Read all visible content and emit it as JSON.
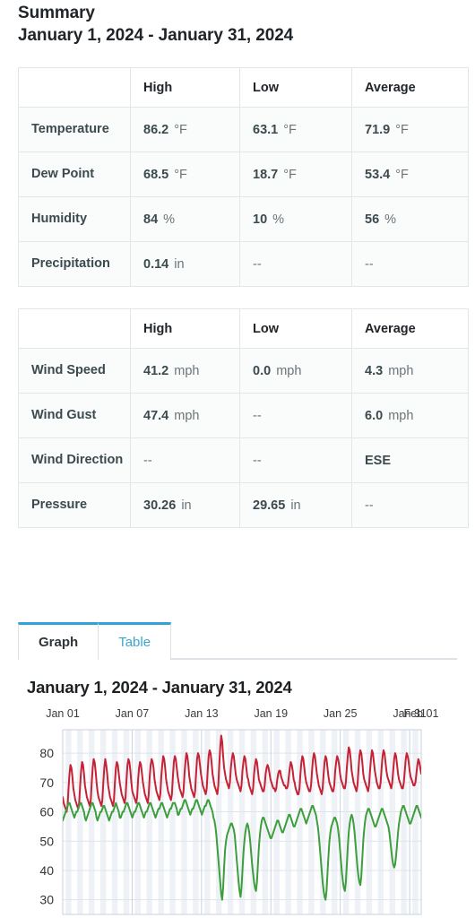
{
  "page": {
    "summary_label": "Summary",
    "date_range": "January 1, 2024 - January 31, 2024"
  },
  "table_main": {
    "headers": [
      "",
      "High",
      "Low",
      "Average"
    ],
    "rows": [
      {
        "label": "Temperature",
        "high": "86.2",
        "high_unit": "°F",
        "low": "63.1",
        "low_unit": "°F",
        "avg": "71.9",
        "avg_unit": "°F"
      },
      {
        "label": "Dew Point",
        "high": "68.5",
        "high_unit": "°F",
        "low": "18.7",
        "low_unit": "°F",
        "avg": "53.4",
        "avg_unit": "°F"
      },
      {
        "label": "Humidity",
        "high": "84",
        "high_unit": "%",
        "low": "10",
        "low_unit": "%",
        "avg": "56",
        "avg_unit": "%"
      },
      {
        "label": "Precipitation",
        "high": "0.14",
        "high_unit": "in",
        "low": "--",
        "low_unit": "",
        "avg": "--",
        "avg_unit": ""
      }
    ]
  },
  "table_wind": {
    "headers": [
      "",
      "High",
      "Low",
      "Average"
    ],
    "rows": [
      {
        "label": "Wind Speed",
        "high": "41.2",
        "high_unit": "mph",
        "low": "0.0",
        "low_unit": "mph",
        "avg": "4.3",
        "avg_unit": "mph"
      },
      {
        "label": "Wind Gust",
        "high": "47.4",
        "high_unit": "mph",
        "low": "--",
        "low_unit": "",
        "avg": "6.0",
        "avg_unit": "mph"
      },
      {
        "label": "Wind Direction",
        "high": "--",
        "high_unit": "",
        "low": "--",
        "low_unit": "",
        "avg": "ESE",
        "avg_unit": ""
      },
      {
        "label": "Pressure",
        "high": "30.26",
        "high_unit": "in",
        "low": "29.65",
        "low_unit": "in",
        "avg": "--",
        "avg_unit": ""
      }
    ]
  },
  "tabs": {
    "items": [
      {
        "label": "Graph",
        "active": true
      },
      {
        "label": "Table",
        "active": false
      }
    ]
  },
  "chart_data": {
    "type": "line",
    "title": "January 1, 2024 - January 31, 2024",
    "xlabel": "",
    "ylabel": "",
    "ylim": [
      25,
      88
    ],
    "yticks": [
      30,
      40,
      50,
      60,
      70,
      80
    ],
    "xtick_labels": [
      "Jan 01",
      "Jan 07",
      "Jan 13",
      "Jan 19",
      "Jan 25",
      "Jan 31",
      "Feb 01"
    ],
    "xtick_days": [
      0,
      6,
      12,
      18,
      24,
      30,
      31
    ],
    "x_range_days": [
      0,
      31
    ],
    "grid": true,
    "legend_position": "none",
    "band_color": "#eef2f7",
    "colors": {
      "temperature": "#c62134",
      "dew_point": "#3c9e3c"
    },
    "series": [
      {
        "name": "Temperature",
        "unit": "°F",
        "color": "#c62134",
        "values": [
          65,
          63,
          62,
          61,
          60,
          62,
          68,
          73,
          76,
          75,
          72,
          68,
          66,
          64,
          63,
          62,
          61,
          63,
          69,
          74,
          77,
          76,
          73,
          69,
          67,
          65,
          64,
          63,
          62,
          64,
          70,
          75,
          78,
          77,
          74,
          70,
          67,
          65,
          64,
          63,
          62,
          64,
          70,
          75,
          78,
          76,
          73,
          69,
          67,
          65,
          64,
          63,
          62,
          64,
          70,
          75,
          77,
          76,
          73,
          70,
          68,
          66,
          65,
          64,
          63,
          65,
          71,
          76,
          78,
          77,
          74,
          70,
          67,
          66,
          65,
          64,
          63,
          65,
          71,
          75,
          77,
          76,
          73,
          70,
          68,
          66,
          65,
          64,
          63,
          66,
          72,
          76,
          78,
          77,
          75,
          71,
          69,
          67,
          66,
          65,
          64,
          66,
          72,
          76,
          79,
          78,
          75,
          71,
          69,
          67,
          66,
          65,
          64,
          66,
          72,
          77,
          79,
          78,
          75,
          72,
          70,
          68,
          67,
          66,
          65,
          67,
          73,
          77,
          80,
          79,
          76,
          72,
          70,
          68,
          67,
          66,
          65,
          67,
          73,
          78,
          80,
          79,
          76,
          73,
          71,
          69,
          68,
          67,
          66,
          68,
          74,
          79,
          81,
          80,
          77,
          73,
          71,
          69,
          68,
          67,
          66,
          69,
          76,
          82,
          86,
          84,
          79,
          75,
          73,
          71,
          70,
          69,
          68,
          70,
          75,
          78,
          80,
          79,
          76,
          73,
          71,
          70,
          69,
          68,
          67,
          69,
          74,
          77,
          79,
          78,
          75,
          72,
          71,
          69,
          68,
          67,
          66,
          68,
          73,
          76,
          78,
          77,
          74,
          71,
          70,
          69,
          68,
          67,
          67,
          69,
          73,
          75,
          76,
          75,
          73,
          71,
          70,
          69,
          68,
          68,
          67,
          68,
          71,
          73,
          74,
          74,
          72,
          71,
          70,
          69,
          69,
          68,
          68,
          69,
          72,
          75,
          77,
          76,
          74,
          71,
          70,
          68,
          67,
          66,
          66,
          68,
          73,
          77,
          79,
          78,
          75,
          72,
          70,
          69,
          68,
          67,
          67,
          69,
          74,
          78,
          80,
          79,
          76,
          73,
          71,
          69,
          68,
          67,
          66,
          68,
          73,
          77,
          79,
          78,
          75,
          72,
          70,
          69,
          68,
          67,
          67,
          69,
          74,
          77,
          79,
          78,
          76,
          73,
          71,
          70,
          69,
          68,
          68,
          70,
          75,
          79,
          82,
          81,
          78,
          74,
          72,
          70,
          69,
          68,
          67,
          69,
          74,
          79,
          81,
          80,
          77,
          73,
          71,
          70,
          69,
          68,
          67,
          69,
          74,
          78,
          81,
          80,
          77,
          74,
          72,
          70,
          69,
          68,
          68,
          70,
          75,
          79,
          81,
          80,
          77,
          74,
          72,
          71,
          70,
          69,
          68,
          70,
          74,
          78,
          80,
          79,
          76,
          73,
          71,
          70,
          69,
          68,
          68,
          70,
          74,
          78,
          80,
          79,
          77,
          74,
          72,
          71,
          70,
          69,
          69,
          70,
          73,
          76,
          78,
          77,
          75,
          73
        ]
      },
      {
        "name": "Dew Point",
        "unit": "°F",
        "color": "#3c9e3c",
        "values": [
          57,
          58,
          59,
          60,
          61,
          62,
          63,
          63,
          62,
          61,
          60,
          59,
          58,
          59,
          60,
          60,
          61,
          62,
          63,
          63,
          62,
          61,
          60,
          58,
          57,
          58,
          59,
          60,
          61,
          62,
          63,
          63,
          62,
          61,
          60,
          58,
          57,
          58,
          59,
          60,
          60,
          61,
          62,
          62,
          61,
          60,
          59,
          58,
          57,
          58,
          59,
          60,
          60,
          61,
          62,
          63,
          62,
          61,
          60,
          58,
          58,
          59,
          60,
          60,
          61,
          62,
          63,
          63,
          62,
          61,
          60,
          59,
          58,
          59,
          60,
          60,
          61,
          62,
          63,
          63,
          62,
          61,
          60,
          59,
          58,
          59,
          60,
          60,
          61,
          62,
          63,
          63,
          62,
          61,
          60,
          59,
          58,
          59,
          60,
          61,
          61,
          62,
          63,
          63,
          62,
          61,
          60,
          59,
          58,
          59,
          60,
          61,
          61,
          62,
          63,
          63,
          63,
          62,
          61,
          59,
          59,
          60,
          61,
          61,
          62,
          63,
          64,
          64,
          63,
          62,
          61,
          60,
          59,
          60,
          61,
          61,
          62,
          63,
          64,
          64,
          63,
          62,
          61,
          60,
          59,
          60,
          61,
          62,
          62,
          63,
          64,
          64,
          63,
          62,
          61,
          60,
          58,
          57,
          55,
          52,
          48,
          44,
          40,
          36,
          32,
          30,
          34,
          41,
          47,
          50,
          52,
          53,
          54,
          55,
          56,
          56,
          55,
          54,
          52,
          48,
          44,
          40,
          36,
          33,
          31,
          34,
          40,
          46,
          50,
          53,
          55,
          56,
          55,
          53,
          50,
          46,
          42,
          39,
          36,
          34,
          33,
          36,
          42,
          48,
          52,
          55,
          57,
          58,
          58,
          57,
          56,
          55,
          54,
          53,
          52,
          51,
          51,
          52,
          53,
          54,
          55,
          56,
          57,
          57,
          56,
          55,
          54,
          53,
          53,
          54,
          55,
          56,
          57,
          58,
          59,
          59,
          58,
          57,
          56,
          55,
          55,
          56,
          57,
          58,
          59,
          60,
          61,
          61,
          60,
          59,
          58,
          57,
          56,
          57,
          58,
          59,
          60,
          61,
          62,
          62,
          61,
          60,
          59,
          57,
          55,
          52,
          48,
          44,
          40,
          36,
          33,
          31,
          30,
          33,
          39,
          45,
          50,
          53,
          55,
          56,
          57,
          58,
          58,
          57,
          56,
          54,
          51,
          47,
          43,
          39,
          36,
          34,
          33,
          36,
          42,
          48,
          53,
          56,
          58,
          59,
          58,
          56,
          53,
          49,
          45,
          41,
          38,
          36,
          35,
          38,
          44,
          50,
          54,
          57,
          59,
          60,
          61,
          61,
          60,
          59,
          58,
          57,
          56,
          55,
          55,
          56,
          57,
          58,
          59,
          60,
          61,
          61,
          60,
          59,
          58,
          57,
          56,
          55,
          53,
          50,
          47,
          44,
          42,
          41,
          42,
          45,
          49,
          53,
          56,
          58,
          60,
          61,
          62,
          62,
          61,
          60,
          59,
          58,
          57,
          56,
          56,
          57,
          58,
          59,
          60,
          61,
          62,
          62,
          61,
          60,
          59,
          58
        ]
      }
    ]
  }
}
